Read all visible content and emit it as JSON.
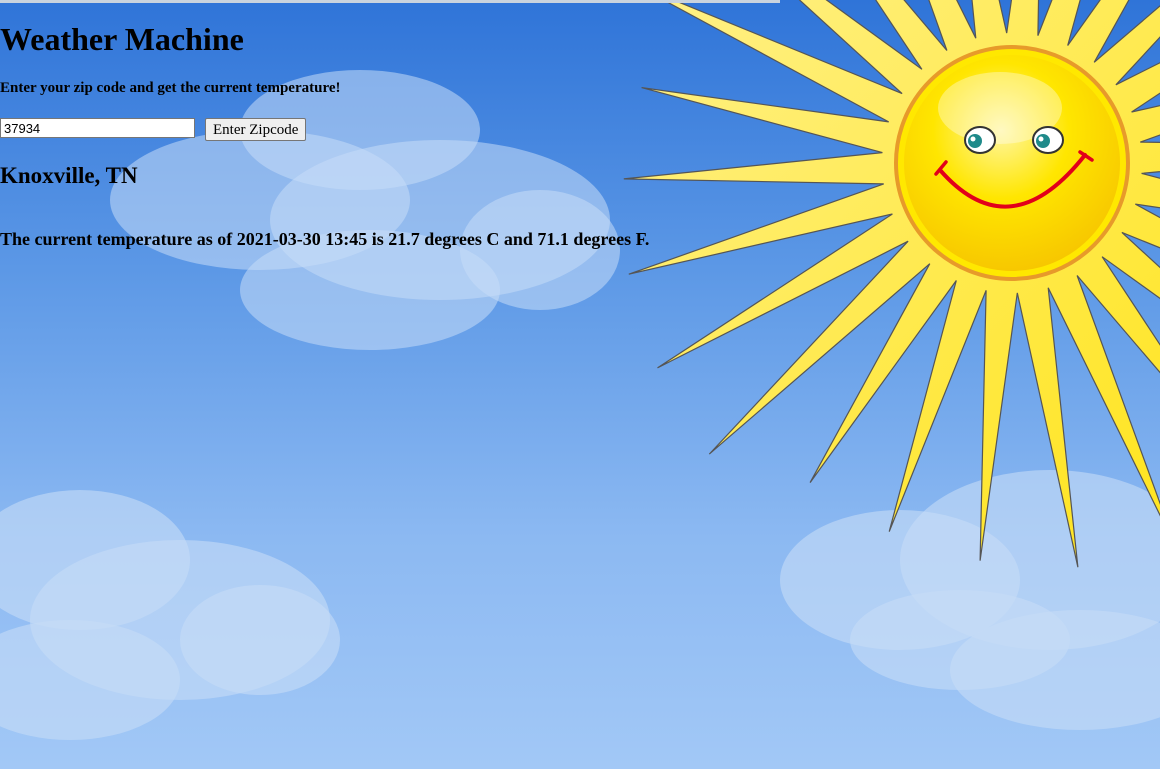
{
  "page": {
    "title": "Weather Machine",
    "instructions": "Enter your zip code and get the current temperature!"
  },
  "form": {
    "zip_value": "37934",
    "submit_label": "Enter Zipcode"
  },
  "result": {
    "location": "Knoxville, TN",
    "temperature_text": "The current temperature as of 2021-03-30 13:45 is 21.7 degrees C and 71.1 degrees F."
  },
  "background": {
    "scene": "sky-with-clouds-and-smiling-sun",
    "sky_top_color": "#2f74d8",
    "sky_bottom_color": "#9ec5f5",
    "sun_color": "#ffe800",
    "sun_face_color": "#ffd900",
    "smile_color": "#e2001a"
  }
}
